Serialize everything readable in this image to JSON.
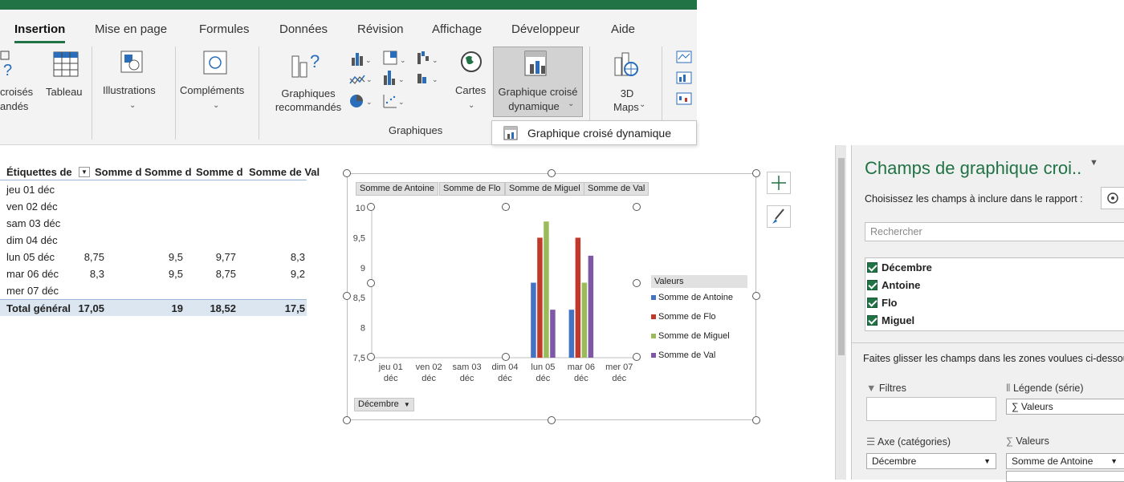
{
  "ribbon": {
    "tabs": [
      "Insertion",
      "Mise en page",
      "Formules",
      "Données",
      "Révision",
      "Affichage",
      "Développeur",
      "Aide"
    ],
    "active_tab": "Insertion",
    "groups": {
      "tcd_line1": "croisés",
      "tcd_line2": "andés",
      "tableau": "Tableau",
      "illustrations": "Illustrations",
      "complements": "Compléments",
      "graph_reco_1": "Graphiques",
      "graph_reco_2": "recommandés",
      "cartes": "Cartes",
      "gcd_line1": "Graphique croisé",
      "gcd_line2": "dynamique",
      "maps_line1": "3D",
      "maps_line2": "Maps",
      "graphiques_group": "Graphiques"
    },
    "dropdown_item": "Graphique croisé dynamique"
  },
  "pivot": {
    "headers": [
      "Étiquettes de",
      "Somme d",
      "Somme d",
      "Somme d",
      "Somme de Val"
    ],
    "rows": [
      {
        "label": "jeu 01 déc",
        "v": [
          "",
          "",
          "",
          ""
        ]
      },
      {
        "label": "ven 02 déc",
        "v": [
          "",
          "",
          "",
          ""
        ]
      },
      {
        "label": "sam 03 déc",
        "v": [
          "",
          "",
          "",
          ""
        ]
      },
      {
        "label": "dim 04 déc",
        "v": [
          "",
          "",
          "",
          ""
        ]
      },
      {
        "label": "lun 05 déc",
        "v": [
          "8,75",
          "9,5",
          "9,77",
          "8,3"
        ]
      },
      {
        "label": "mar 06 déc",
        "v": [
          "8,3",
          "9,5",
          "8,75",
          "9,2"
        ]
      },
      {
        "label": "mer 07 déc",
        "v": [
          "",
          "",
          "",
          ""
        ]
      }
    ],
    "total": {
      "label": "Total général",
      "v": [
        "17,05",
        "19",
        "18,52",
        "17,5"
      ]
    }
  },
  "chart_data": {
    "type": "bar",
    "categories": [
      "jeu 01 déc",
      "ven 02 déc",
      "sam 03 déc",
      "dim 04 déc",
      "lun 05 déc",
      "mar 06 déc",
      "mer 07 déc"
    ],
    "series": [
      {
        "name": "Somme de Antoine",
        "color": "#4472c4",
        "values": [
          null,
          null,
          null,
          null,
          8.75,
          8.3,
          null
        ]
      },
      {
        "name": "Somme de Flo",
        "color": "#c0392b",
        "values": [
          null,
          null,
          null,
          null,
          9.5,
          9.5,
          null
        ]
      },
      {
        "name": "Somme de Miguel",
        "color": "#9bbb59",
        "values": [
          null,
          null,
          null,
          null,
          9.77,
          8.75,
          null
        ]
      },
      {
        "name": "Somme de Val",
        "color": "#7e57a6",
        "values": [
          null,
          null,
          null,
          null,
          8.3,
          9.2,
          null
        ]
      }
    ],
    "ylim": [
      7.5,
      10
    ],
    "yticks": [
      "10",
      "9,5",
      "9",
      "8,5",
      "8",
      "7,5"
    ],
    "yticks_values": [
      10,
      9.5,
      9,
      8.5,
      8,
      7.5
    ],
    "field_buttons": [
      "Somme de Antoine",
      "Somme de Flo",
      "Somme de Miguel",
      "Somme de Val"
    ],
    "legend_title": "Valeurs",
    "axis_field_button": "Décembre"
  },
  "pane": {
    "title": "Champs de graphique croi..",
    "subtitle": "Choisissez les champs à inclure dans le rapport :",
    "search_placeholder": "Rechercher",
    "fields": [
      "Décembre",
      "Antoine",
      "Flo",
      "Miguel"
    ],
    "drag_hint": "Faites glisser les champs dans les zones voulues ci-dessous",
    "zones": {
      "filters": "Filtres",
      "legend": "Légende (série)",
      "legend_item": "Valeurs",
      "axis": "Axe (catégories)",
      "values": "Valeurs",
      "axis_item": "Décembre",
      "values_item": "Somme de Antoine"
    }
  }
}
